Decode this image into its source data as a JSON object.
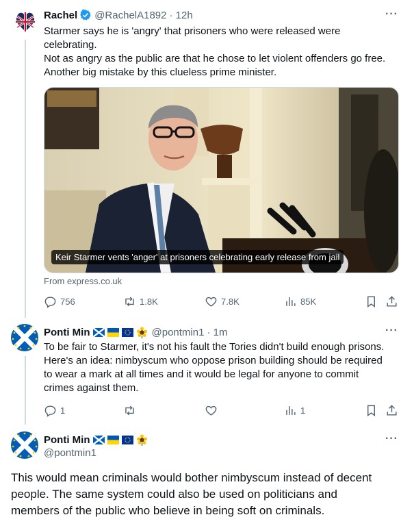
{
  "tweet1": {
    "name": "Rachel",
    "handle": "@RachelA1892",
    "time": "· 12h",
    "lines": [
      "Starmer says he is 'angry' that prisoners who were released were",
      "celebrating.",
      "Not as angry as the public are that he chose to let violent offenders go free.",
      "Another big mistake by this clueless prime minister."
    ],
    "card_caption": "Keir Starmer vents 'anger' at prisoners celebrating early release from jail",
    "card_source": "From express.co.uk",
    "replies": "756",
    "reposts": "1.8K",
    "likes": "7.8K",
    "views": "85K"
  },
  "tweet2": {
    "name": "Ponti Min",
    "handle": "@pontmin1",
    "time": "· 1m",
    "lines": [
      "To be fair to Starmer, it's not his fault the Tories didn't build enough prisons.",
      "Here's an idea: nimbyscum who oppose prison building should be required",
      "to wear a mark at all times and it would be legal for anyone to commit",
      "crimes against them."
    ],
    "replies": "1",
    "views": "1"
  },
  "tweet3": {
    "name": "Ponti Min",
    "handle": "@pontmin1",
    "lines": [
      "This would mean criminals would bother nimbyscum instead of decent",
      "people. The same system could also be used on politicians and",
      "members of the public who believe in being soft on criminals."
    ]
  },
  "more_label": "···",
  "colors": {
    "verified": "#1d9bf0",
    "secondary": "#536471",
    "divider": "#eff3f4"
  },
  "icons": [
    "reply-icon",
    "repost-icon",
    "like-icon",
    "views-icon",
    "bookmark-icon",
    "share-icon",
    "verified-badge-icon",
    "flag-icons"
  ]
}
